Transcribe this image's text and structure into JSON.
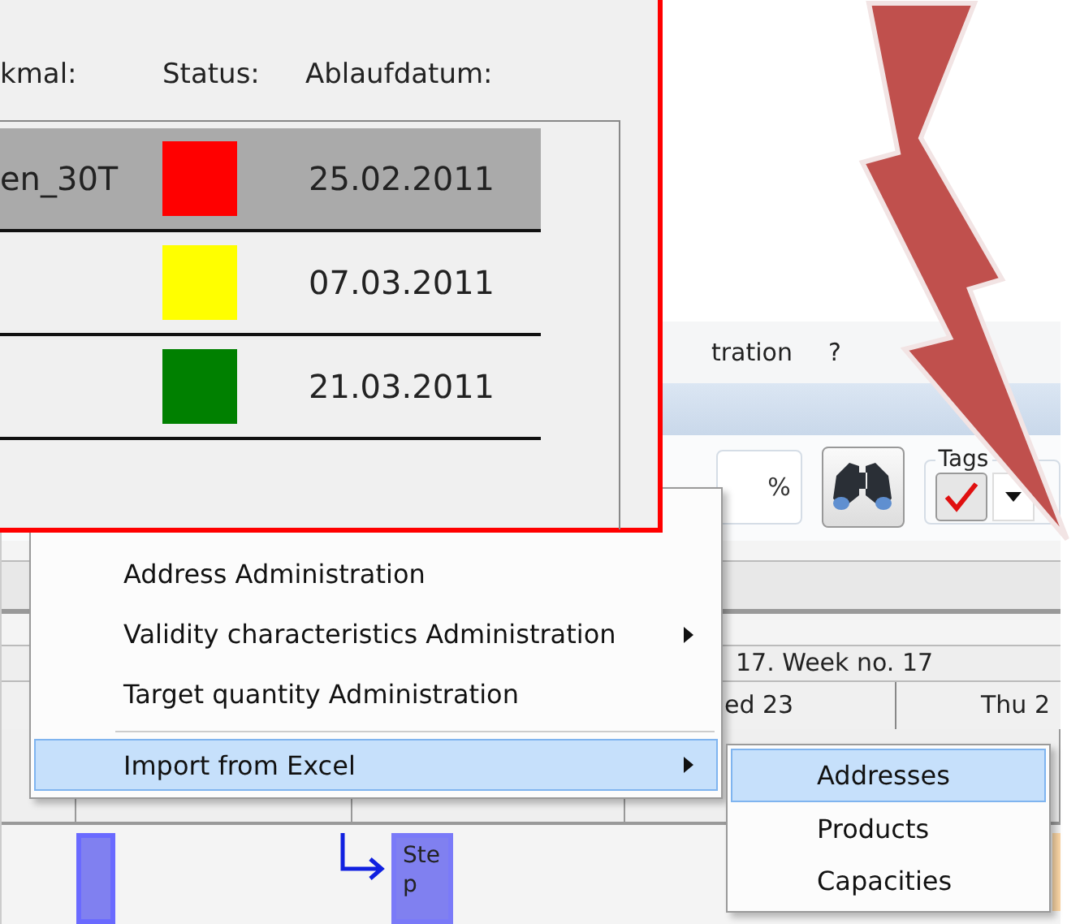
{
  "app": {
    "menu_bar": [
      {
        "label": "tration"
      },
      {
        "label": "?"
      }
    ],
    "toolbar": {
      "percent": "%",
      "tags_label": "Tags",
      "tag_checked": true
    },
    "timeline": {
      "week": "17. Week no. 17",
      "days": [
        "ed 23",
        "Thu 2"
      ]
    },
    "task": {
      "label": "Step"
    }
  },
  "context_menu": {
    "items": [
      {
        "label": "Address Administration",
        "submenu": false,
        "selected": false
      },
      {
        "label": "Validity characteristics Administration",
        "submenu": true,
        "selected": false
      },
      {
        "label": "Target quantity Administration",
        "submenu": false,
        "selected": false
      },
      {
        "label": "Import from Excel",
        "submenu": true,
        "selected": true,
        "separator_before": true
      }
    ]
  },
  "submenu": {
    "items": [
      {
        "label": "Addresses",
        "selected": true
      },
      {
        "label": "Products",
        "selected": false
      },
      {
        "label": "Capacities",
        "selected": false
      }
    ]
  },
  "status_window": {
    "columns": [
      "kmal:",
      "Status:",
      "Ablaufdatum:"
    ],
    "rows": [
      {
        "name": "en_30T",
        "color": "#ff0000",
        "date": "25.02.2011",
        "selected": true
      },
      {
        "name": "",
        "color": "#ffff00",
        "date": "07.03.2011",
        "selected": false
      },
      {
        "name": "",
        "color": "#008000",
        "date": "21.03.2011",
        "selected": false
      }
    ]
  }
}
